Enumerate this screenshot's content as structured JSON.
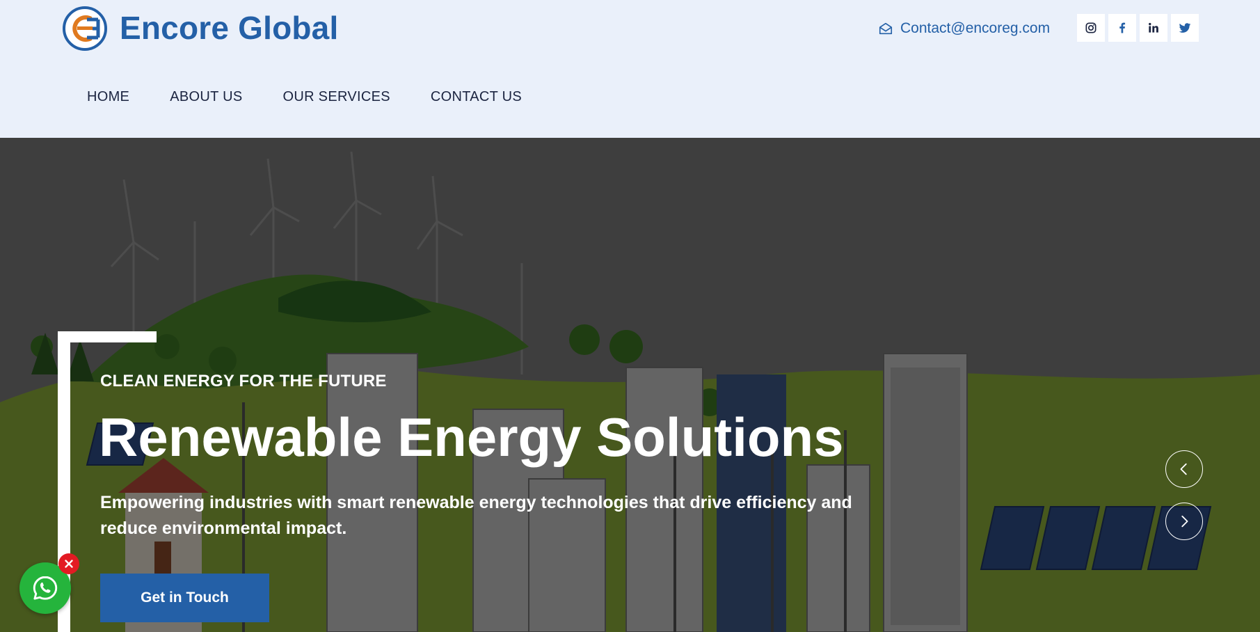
{
  "brand": {
    "name": "Encore Global",
    "logo_icon": "encore-global-logo",
    "colors": {
      "primary": "#2460a7",
      "accent": "#e07a1f",
      "header_bg": "#eaf0fa"
    }
  },
  "header": {
    "contact": {
      "icon": "mail-open-icon",
      "email": "Contact@encoreg.com"
    },
    "socials": [
      {
        "name": "instagram",
        "icon": "instagram-icon"
      },
      {
        "name": "facebook",
        "icon": "facebook-icon"
      },
      {
        "name": "linkedin",
        "icon": "linkedin-icon"
      },
      {
        "name": "twitter",
        "icon": "twitter-icon"
      }
    ]
  },
  "nav": {
    "items": [
      {
        "label": "HOME"
      },
      {
        "label": "ABOUT US"
      },
      {
        "label": "OUR SERVICES"
      },
      {
        "label": "CONTACT US"
      }
    ]
  },
  "hero": {
    "eyebrow": "CLEAN ENERGY FOR THE FUTURE",
    "title": "Renewable Energy Solutions",
    "subtitle": "Empowering industries with smart renewable energy technologies that drive efficiency and reduce environmental impact.",
    "cta_label": "Get in Touch",
    "prev_icon": "chevron-left-icon",
    "next_icon": "chevron-right-icon"
  },
  "floating": {
    "whatsapp_icon": "whatsapp-icon",
    "close_icon": "close-icon",
    "whatsapp_color": "#25b43c",
    "close_color": "#e31b23"
  }
}
